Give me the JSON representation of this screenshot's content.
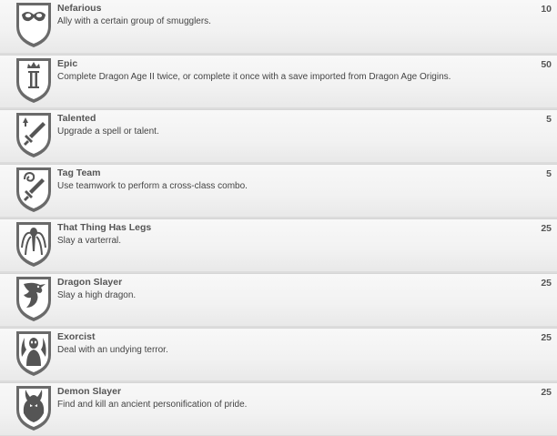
{
  "achievements": [
    {
      "title": "Nefarious",
      "description": "Ally with a certain group of smugglers.",
      "points": "10",
      "icon": "mask-icon"
    },
    {
      "title": "Epic",
      "description": "Complete Dragon Age II twice, or complete it once with a save imported from Dragon Age Origins.",
      "points": "50",
      "icon": "crown-roman-two-icon"
    },
    {
      "title": "Talented",
      "description": "Upgrade a spell or talent.",
      "points": "5",
      "icon": "sword-arrow-icon"
    },
    {
      "title": "Tag Team",
      "description": "Use teamwork to perform a cross-class combo.",
      "points": "5",
      "icon": "swirl-sword-icon"
    },
    {
      "title": "That Thing Has Legs",
      "description": "Slay a varterral.",
      "points": "25",
      "icon": "varterral-icon"
    },
    {
      "title": "Dragon Slayer",
      "description": "Slay a high dragon.",
      "points": "25",
      "icon": "dragon-icon"
    },
    {
      "title": "Exorcist",
      "description": "Deal with an undying terror.",
      "points": "25",
      "icon": "ghost-icon"
    },
    {
      "title": "Demon Slayer",
      "description": "Find and kill an ancient personification of pride.",
      "points": "25",
      "icon": "demon-icon"
    }
  ]
}
